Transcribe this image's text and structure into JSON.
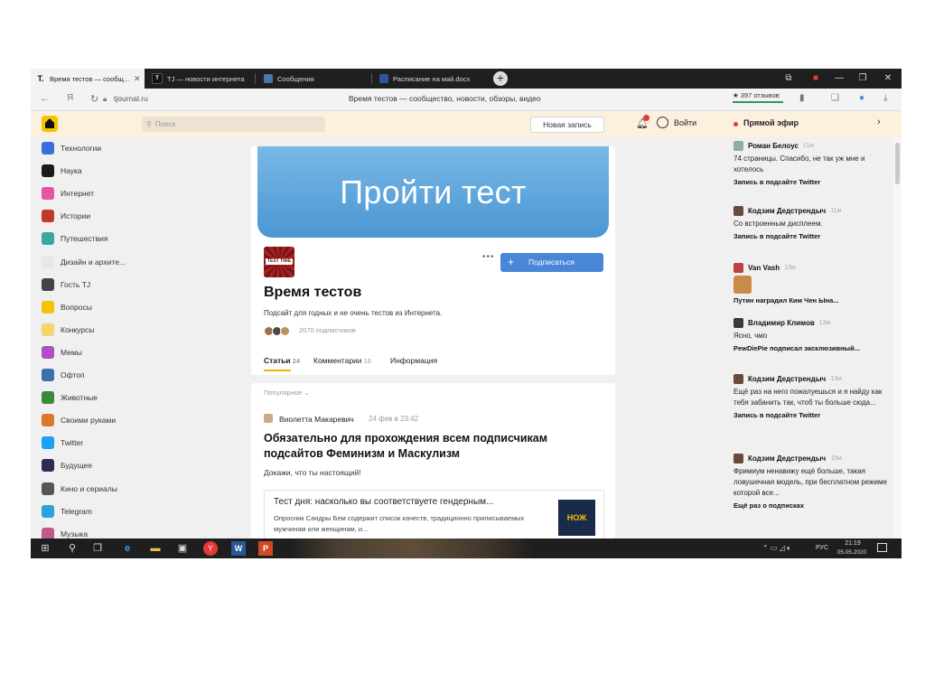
{
  "browser": {
    "tabs": [
      {
        "label": "Время тестов — сообщ...",
        "icon": "tj-icon",
        "active": true
      },
      {
        "label": "TJ — новости интернета",
        "icon": "tj-icon",
        "active": false
      },
      {
        "label": "Сообщения",
        "icon": "messages-icon",
        "active": false
      },
      {
        "label": "Расписание на май.docx",
        "icon": "docx-icon",
        "active": false
      }
    ],
    "url": "tjournal.ru",
    "page_heading": "Время тестов — сообщество, новости, обзоры, видео",
    "reviews": "★ 397 отзывов",
    "back_label": "←",
    "yandex_label": "Я",
    "reload_label": "↻"
  },
  "header": {
    "search_placeholder": "Поиск",
    "new_post": "Новая запись",
    "login": "Войти",
    "live": "Прямой эфир"
  },
  "sidebar": {
    "items": [
      {
        "label": "Технологии",
        "color": "#3b6fd6"
      },
      {
        "label": "Наука",
        "color": "#1a1a1a"
      },
      {
        "label": "Интернет",
        "color": "#e8559a"
      },
      {
        "label": "Истории",
        "color": "#c0392b"
      },
      {
        "label": "Путешествия",
        "color": "#3aa8a0"
      },
      {
        "label": "Дизайн и архите...",
        "color": "#e8e8e8"
      },
      {
        "label": "Гость TJ",
        "color": "#444444"
      },
      {
        "label": "Вопросы",
        "color": "#f5c400"
      },
      {
        "label": "Конкурсы",
        "color": "#f7d36b"
      },
      {
        "label": "Мемы",
        "color": "#b04fc0"
      },
      {
        "label": "Офтоп",
        "color": "#3d6fb0"
      },
      {
        "label": "Животные",
        "color": "#3a8a3a"
      },
      {
        "label": "Своими руками",
        "color": "#d97a2b"
      },
      {
        "label": "Twitter",
        "color": "#1da1f2"
      },
      {
        "label": "Будущее",
        "color": "#2c2c54"
      },
      {
        "label": "Кино и сериалы",
        "color": "#555555"
      },
      {
        "label": "Telegram",
        "color": "#2aa3dd"
      },
      {
        "label": "Музыка",
        "color": "#c05a8a"
      }
    ]
  },
  "profile": {
    "banner_text": "Пройти тест",
    "avatar_text": "TEST TIME",
    "more": "•••",
    "subscribe": "Подписаться",
    "title": "Время тестов",
    "description": "Подсайт для годных и не очень тестов из Интернета.",
    "subscribers": "2070 подписчиков",
    "tabs": [
      {
        "label": "Статьи",
        "count": "24"
      },
      {
        "label": "Комментарии",
        "count": "16"
      },
      {
        "label": "Информация",
        "count": ""
      }
    ]
  },
  "post": {
    "sort": "Популярное ⌄",
    "author": "Виолетта Макаревич",
    "date": "24 фев в 23:42",
    "title": "Обязательно для прохождения всем подписчикам подсайтов Феминизм и Маскулизм",
    "lead": "Докажи, что ты настоящий!",
    "link_title": "Тест дня: насколько вы соответствуете гендерным...",
    "link_text": "Опросник Сандры Бем содержит список качеств, традиционно приписываемых мужчинам или женщинам, и...",
    "link_thumb": "НОЖ"
  },
  "feed": [
    {
      "name": "Роман Белоус",
      "time": "11м",
      "text": "74 страницы. Спасибо, не так уж мне и хотелось",
      "source": "Запись в подсайте Twitter",
      "avatar_color": "#8ab0a0"
    },
    {
      "name": "Кодзим Дедстрендыч",
      "time": "11м",
      "text": "Со встроенным дисплеем.",
      "source": "Запись в подсайте Twitter",
      "avatar_color": "#6a4a3a"
    },
    {
      "name": "Van Vash",
      "time": "13м",
      "text": "",
      "source": "Путин наградил Ким Чен Ына...",
      "avatar_color": "#c04040"
    },
    {
      "name": "Владимир Климов",
      "time": "13м",
      "text": "Ясно, чмо",
      "source": "PewDiePie подписал эксклюзивный...",
      "avatar_color": "#3a3a3a"
    },
    {
      "name": "Кодзим Дедстрендыч",
      "time": "13м",
      "text": "Ещё раз на него пожалуешься и я найду как тебя забанить так, чтоб ты больше сюда...",
      "source": "Запись в подсайте Twitter",
      "avatar_color": "#6a4a3a"
    },
    {
      "name": "Кодзим Дедстрендыч",
      "time": "15м",
      "text": "Фримиум ненавижу ещё больше, такая ловушечная модель, при бесплатном режиме которой все...",
      "source": "Ещё раз о подписках",
      "avatar_color": "#6a4a3a"
    }
  ],
  "taskbar": {
    "lang": "РУС",
    "time": "21:19",
    "date": "05.05.2020"
  }
}
